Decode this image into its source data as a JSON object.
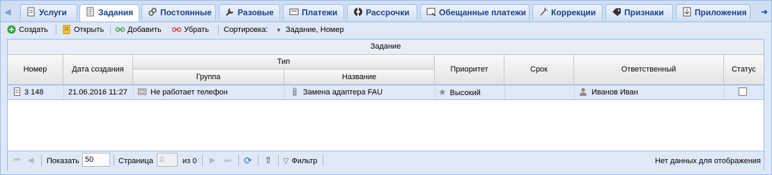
{
  "tabs": [
    {
      "label": "Услуги",
      "icon": "document-icon",
      "active": false
    },
    {
      "label": "Задания",
      "icon": "task-icon",
      "active": true
    },
    {
      "label": "Постоянные",
      "icon": "link-icon",
      "active": false
    },
    {
      "label": "Разовые",
      "icon": "wrench-icon",
      "active": false
    },
    {
      "label": "Платежи",
      "icon": "payment-icon",
      "active": false
    },
    {
      "label": "Рассрочки",
      "icon": "lifebuoy-icon",
      "active": false
    },
    {
      "label": "Обещанные платежи",
      "icon": "promised-payment-icon",
      "active": false
    },
    {
      "label": "Коррекции",
      "icon": "wand-icon",
      "active": false
    },
    {
      "label": "Признаки",
      "icon": "tag-icon",
      "active": false
    },
    {
      "label": "Приложения",
      "icon": "attachment-icon",
      "active": false
    }
  ],
  "toolbar": {
    "create": "Создать",
    "open": "Открыть",
    "add": "Добавить",
    "remove": "Убрать",
    "sort_label": "Сортировка:",
    "sort_value": "Задание, Номер"
  },
  "grid": {
    "title": "Задание",
    "headers": {
      "number": "Номер",
      "created": "Дата создания",
      "type": "Тип",
      "group": "Группа",
      "name": "Название",
      "priority": "Приоритет",
      "deadline": "Срок",
      "responsible": "Ответственный",
      "status": "Статус"
    },
    "rows": [
      {
        "number": "3 148",
        "created": "21.06.2016 11:27",
        "group": "Не работает телефон",
        "name": "Замена адаптера FAU",
        "priority": "Высокий",
        "deadline": "",
        "responsible": "Иванов Иван",
        "status_checked": false
      }
    ]
  },
  "paging": {
    "show_label": "Показать",
    "page_size": "50",
    "page_label": "Страница",
    "page_value": "0",
    "of_label": "из 0",
    "filter_label": "Фильтр",
    "empty_message": "Нет данных для отображения"
  },
  "colors": {
    "accent": "#15428b",
    "border": "#99bce8",
    "selected_row": "#dfe8f6",
    "create_green": "#2e9e3a",
    "remove_red": "#d03a3a"
  }
}
